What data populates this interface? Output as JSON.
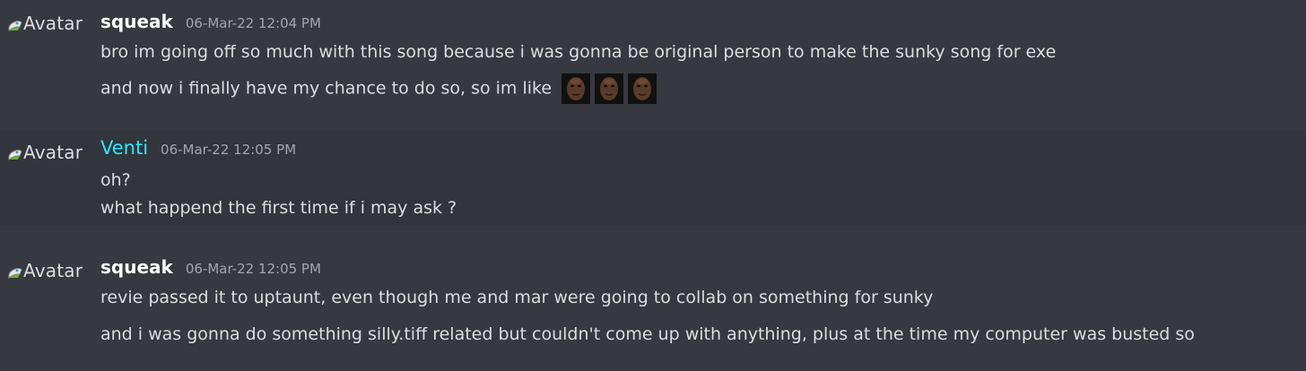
{
  "messages": [
    {
      "avatar_alt": "Avatar",
      "username": "squeak",
      "timestamp": "06-Mar-22 12:04 PM",
      "lines": [
        "bro im going off so much with this song because i was gonna be original person to make the sunky song for exe",
        "and now i finally have my chance to do so, so im like"
      ],
      "emoji_count": 3,
      "emoji_icon": "face-emoji-icon"
    },
    {
      "avatar_alt": "Avatar",
      "username": "Venti",
      "username_color": "#2ee6ff",
      "timestamp": "06-Mar-22 12:05 PM",
      "lines": [
        "oh?",
        "what happend the first time if i may ask ?"
      ]
    },
    {
      "avatar_alt": "Avatar",
      "username": "squeak",
      "timestamp": "06-Mar-22 12:05 PM",
      "lines": [
        "revie passed it to uptaunt, even though me and mar were going to collab on something for sunky",
        "and i was gonna do something silly.tiff related but couldn't come up with anything, plus at the time my computer was busted so"
      ]
    }
  ],
  "colors": {
    "background": "#36393f",
    "alt_background": "#32353b",
    "text": "#dcddde",
    "timestamp": "#a3a6aa"
  }
}
